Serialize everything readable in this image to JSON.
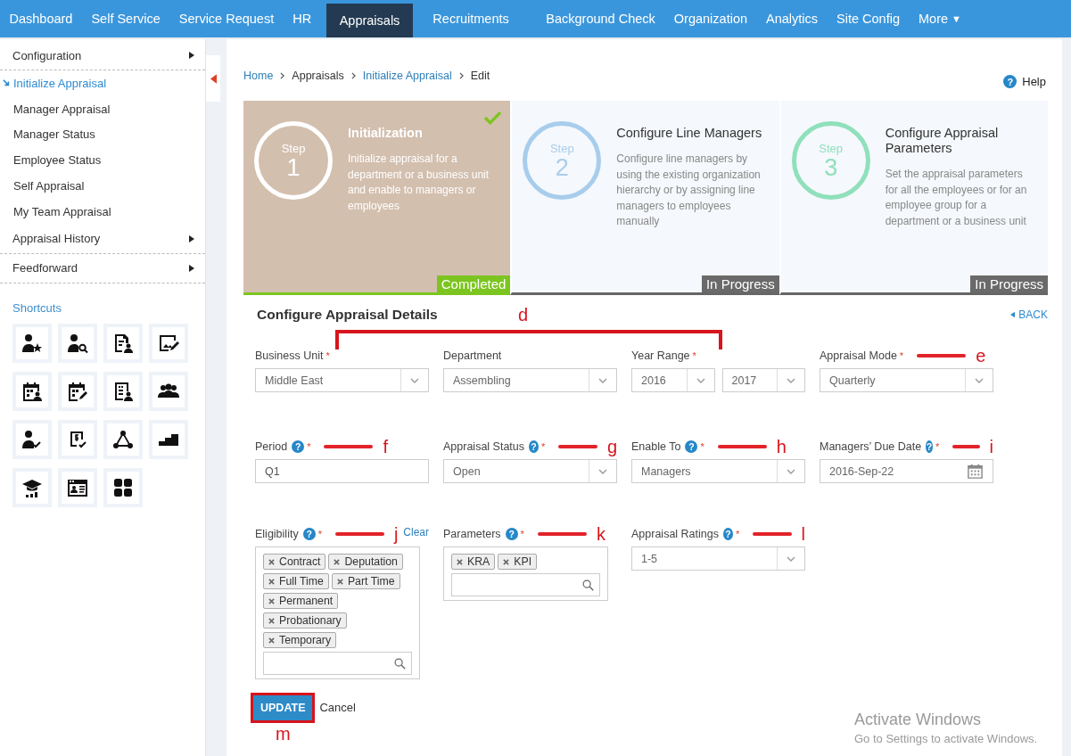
{
  "nav": [
    {
      "label": "Dashboard",
      "selected": false
    },
    {
      "label": "Self Service",
      "selected": false
    },
    {
      "label": "Service Request",
      "selected": false
    },
    {
      "label": "HR",
      "selected": false
    },
    {
      "label": "Appraisals",
      "selected": true
    },
    {
      "label": "Recruitments",
      "selected": false
    },
    {
      "label": "Background Check",
      "selected": false
    },
    {
      "label": "Organization",
      "selected": false
    },
    {
      "label": "Analytics",
      "selected": false
    },
    {
      "label": "Site Config",
      "selected": false
    },
    {
      "label": "More",
      "selected": false,
      "caret": "▼"
    }
  ],
  "sidebar": {
    "items": [
      {
        "label": "Configuration",
        "kind": "group",
        "selected": false
      },
      {
        "label": "Initialize Appraisal",
        "kind": "link",
        "selected": true
      },
      {
        "label": "Manager Appraisal",
        "kind": "link",
        "selected": false
      },
      {
        "label": "Manager Status",
        "kind": "link",
        "selected": false
      },
      {
        "label": "Employee Status",
        "kind": "link",
        "selected": false
      },
      {
        "label": "Self Appraisal",
        "kind": "link",
        "selected": false
      },
      {
        "label": "My Team Appraisal",
        "kind": "link",
        "selected": false
      },
      {
        "label": "Appraisal History",
        "kind": "group",
        "selected": false
      },
      {
        "label": "Feedforward",
        "kind": "group",
        "selected": false
      }
    ],
    "shortcuts_title": "Shortcuts"
  },
  "breadcrumbs": [
    {
      "label": "Home",
      "link": true
    },
    {
      "label": "Appraisals",
      "link": false
    },
    {
      "label": "Initialize Appraisal",
      "link": true
    },
    {
      "label": "Edit",
      "link": false
    }
  ],
  "help": {
    "icon": "?",
    "label": "Help"
  },
  "steps": [
    {
      "step_word": "Step",
      "number": "1",
      "title": "Initialization",
      "description": "Initialize appraisal for a department or a business unit and enable to managers or employees",
      "status": "Completed",
      "completed": true,
      "checked": true,
      "color": "#ffffff"
    },
    {
      "step_word": "Step",
      "number": "2",
      "title": "Configure Line Managers",
      "description": "Configure line managers by using the existing organization hierarchy or by assigning line managers to employees manually",
      "status": "In Progress",
      "completed": false,
      "checked": false,
      "color": "#a8cdec"
    },
    {
      "step_word": "Step",
      "number": "3",
      "title": "Configure Appraisal Parameters",
      "description": "Set the appraisal parameters for all the employees or for an employee group for a department or a business unit",
      "status": "In Progress",
      "completed": false,
      "checked": false,
      "color": "#8fe0bb"
    }
  ],
  "form": {
    "title": "Configure Appraisal Details",
    "back": "BACK",
    "bracket_callout": "d",
    "rows": [
      [
        {
          "label": "Business Unit",
          "required_mark": "*",
          "kind": "select",
          "value": "Middle East"
        },
        {
          "label": "Department",
          "kind": "select",
          "value": "Assembling"
        },
        {
          "label": "Year Range",
          "required_mark": "*",
          "kind": "select_pair",
          "values": [
            "2016",
            "2017"
          ]
        },
        {
          "label": "Appraisal Mode",
          "required_mark": "*",
          "kind": "select",
          "value": "Quarterly",
          "callout": "e"
        }
      ],
      [
        {
          "label": "Period",
          "help": "?",
          "required_mark": "*",
          "kind": "text",
          "value": "Q1",
          "callout": "f"
        },
        {
          "label": "Appraisal Status",
          "help": "?",
          "required_mark": "*",
          "kind": "select",
          "value": "Open",
          "callout": "g"
        },
        {
          "label": "Enable To",
          "help": "?",
          "required_mark": "*",
          "kind": "select",
          "value": "Managers",
          "callout": "h"
        },
        {
          "label": "Managers’ Due Date",
          "help": "?",
          "required_mark": "*",
          "kind": "date",
          "value": "2016-Sep-22",
          "callout": "i"
        }
      ],
      [
        {
          "label": "Eligibility",
          "help": "?",
          "required_mark": "*",
          "kind": "tags",
          "tags": [
            "Contract",
            "Deputation",
            "Full Time",
            "Part Time",
            "Permanent",
            "Probationary",
            "Temporary"
          ],
          "callout": "j",
          "action": "Clear"
        },
        {
          "label": "Parameters",
          "help": "?",
          "required_mark": "*",
          "kind": "tags",
          "tags": [
            "KRA",
            "KPI"
          ],
          "callout": "k"
        },
        {
          "label": "Appraisal Ratings",
          "help": "?",
          "required_mark": "*",
          "kind": "select",
          "value": "1-5",
          "callout": "l"
        }
      ]
    ],
    "update": {
      "label": "UPDATE",
      "callout": "m"
    },
    "cancel": "Cancel"
  },
  "os_notice": {
    "title": "Activate Windows",
    "subtitle": "Go to Settings to activate Windows."
  }
}
